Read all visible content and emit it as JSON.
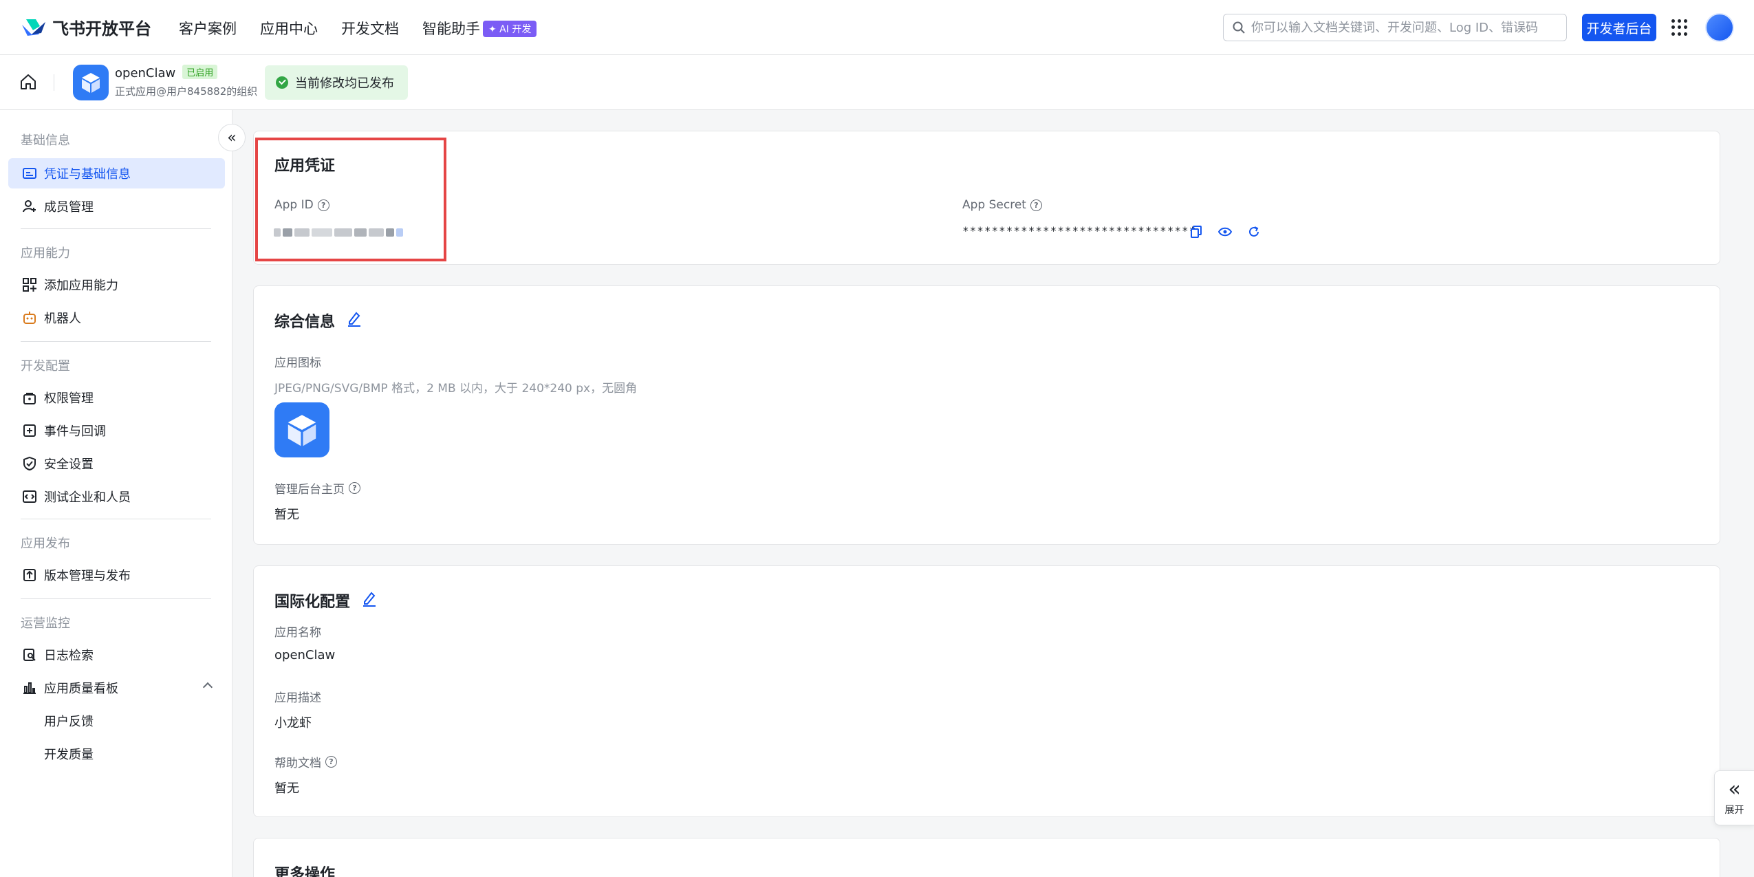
{
  "header": {
    "brand": "飞书开放平台",
    "nav": [
      "客户案例",
      "应用中心",
      "开发文档",
      "智能助手"
    ],
    "ai_badge": "✦ AI 开发",
    "search_placeholder": "你可以输入文档关键词、开发问题、Log ID、错误码",
    "dev_console": "开发者后台"
  },
  "app_bar": {
    "name": "openClaw",
    "status": "已启用",
    "org": "正式应用@用户845882的组织",
    "publish_status": "当前修改均已发布"
  },
  "sidebar": {
    "sections": [
      {
        "title": "基础信息",
        "items": [
          "凭证与基础信息",
          "成员管理"
        ]
      },
      {
        "title": "应用能力",
        "items": [
          "添加应用能力",
          "机器人"
        ]
      },
      {
        "title": "开发配置",
        "items": [
          "权限管理",
          "事件与回调",
          "安全设置",
          "测试企业和人员"
        ]
      },
      {
        "title": "应用发布",
        "items": [
          "版本管理与发布"
        ]
      },
      {
        "title": "运营监控",
        "items": [
          "日志检索",
          "应用质量看板",
          "用户反馈",
          "开发质量"
        ]
      }
    ]
  },
  "credentials": {
    "title": "应用凭证",
    "app_id_label": "App ID",
    "app_secret_label": "App Secret",
    "app_secret_value": "********************************"
  },
  "general": {
    "title": "综合信息",
    "icon_label": "应用图标",
    "icon_hint": "JPEG/PNG/SVG/BMP 格式，2 MB 以内，大于 240*240 px，无圆角",
    "admin_home_label": "管理后台主页",
    "admin_home_value": "暂无"
  },
  "i18n": {
    "title": "国际化配置",
    "name_label": "应用名称",
    "name_value": "openClaw",
    "desc_label": "应用描述",
    "desc_value": "小龙虾",
    "help_label": "帮助文档",
    "help_value": "暂无"
  },
  "more": {
    "title": "更多操作"
  },
  "float": {
    "expand": "展开"
  }
}
